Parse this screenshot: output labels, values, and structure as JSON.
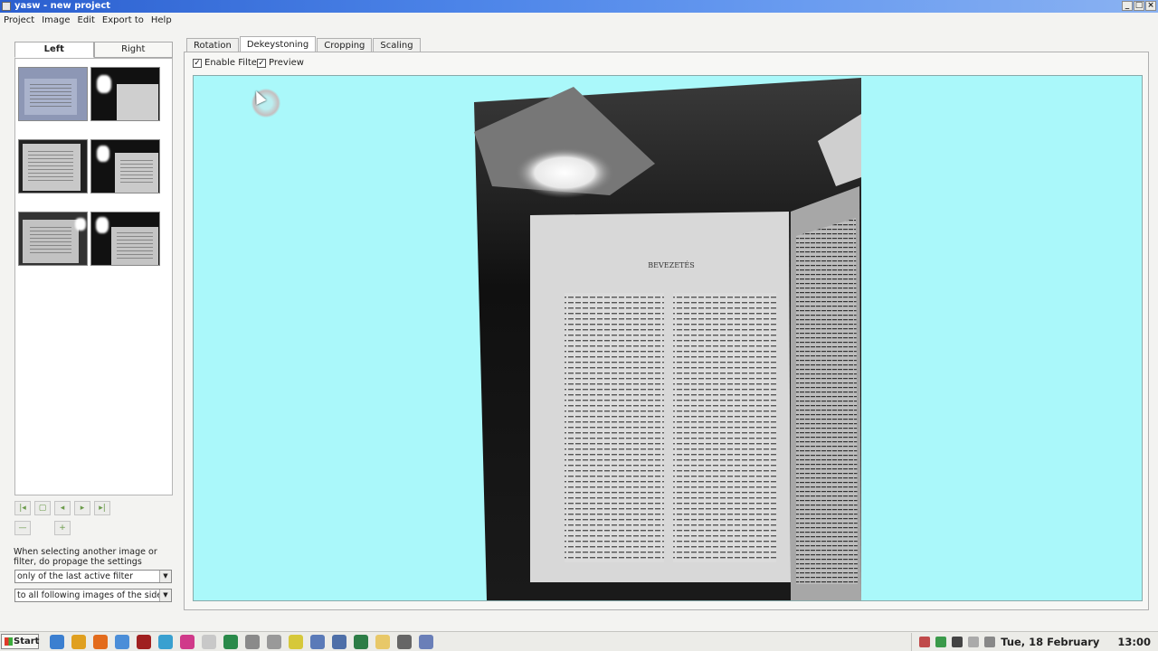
{
  "window": {
    "title": "yasw - new project"
  },
  "menu": [
    "Project",
    "Image",
    "Edit",
    "Export to",
    "Help"
  ],
  "side_tabs": {
    "left": "Left",
    "right": "Right"
  },
  "filter_tabs": {
    "rotation": "Rotation",
    "dekeystoning": "Dekeystoning",
    "cropping": "Cropping",
    "scaling": "Scaling"
  },
  "options": {
    "enable_filter": "Enable Filter",
    "enable_filter_checked": true,
    "preview": "Preview",
    "preview_checked": true
  },
  "propagate": {
    "label": "When selecting another image or filter, do propage the settings",
    "filter_choice": "only of the last active filter",
    "image_choice": "to all following images of the side"
  },
  "preview_image": {
    "page_heading": "BEVEZETÉS"
  },
  "colors": {
    "preview_bg": "#aaf8fa",
    "titlebar": "#2b5fcf"
  },
  "taskbar": {
    "start_label": "Start",
    "date": "Tue, 18 February",
    "time": "13:00"
  }
}
